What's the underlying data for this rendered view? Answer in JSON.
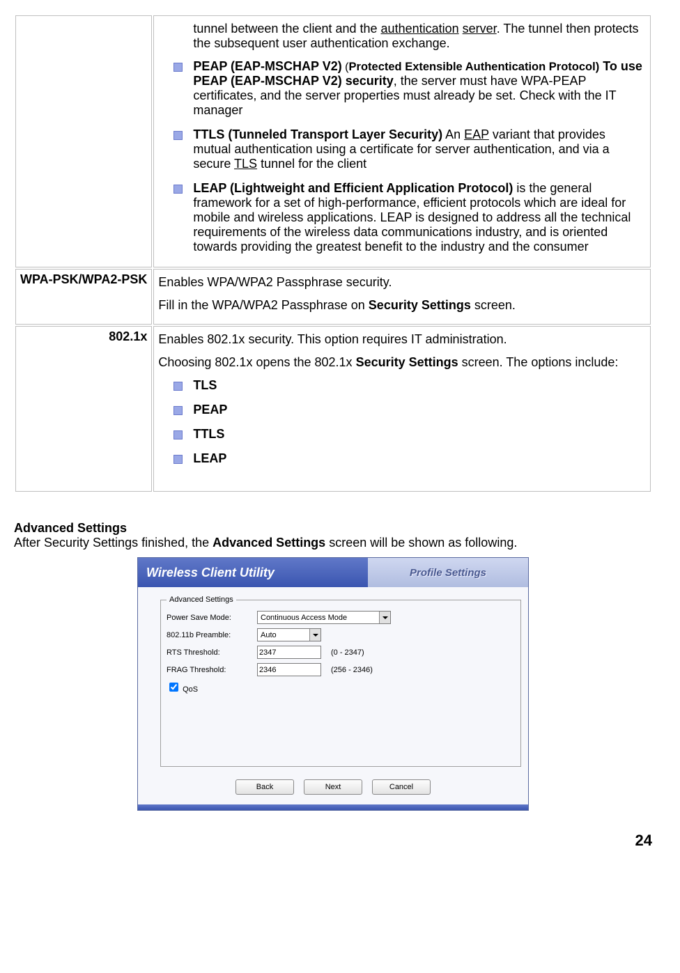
{
  "table": {
    "intro_text_pre": "tunnel between the client and the ",
    "intro_link1": "authentication",
    "intro_text_mid": " ",
    "intro_link2": "server",
    "intro_text_post": ". The tunnel then protects the subsequent user authentication exchange.",
    "items": [
      {
        "lead_bold": "PEAP (EAP-MSCHAP V2)",
        "lead_small": " (",
        "lead_bold2": "Protected Extensible Authentication Protocol)",
        "mid_bold": " To use PEAP (EAP-MSCHAP V2) security",
        "rest": ", the server must have WPA-PEAP certificates, and the server properties must already be set. Check with the IT manager"
      },
      {
        "lead_bold": "TTLS  (Tunneled Transport Layer Security)",
        "rest_pre": " An ",
        "link1": "EAP",
        "rest_mid": " variant that provides mutual authentication using a certificate for server authentication, and via a secure ",
        "link2": "TLS",
        "rest_post": " tunnel for the client"
      },
      {
        "lead_bold": "LEAP    (Lightweight and Efficient Application Protocol)",
        "rest": " is the general framework for a set of high-performance, efficient protocols which are ideal for mobile and wireless applications. LEAP is designed to address all the technical requirements of the wireless data communications industry, and is oriented towards providing the greatest benefit to the industry and the consumer"
      }
    ],
    "row2": {
      "label": "WPA-PSK/WPA2-PSK",
      "line1": "Enables WPA/WPA2 Passphrase security.",
      "line2_pre": "Fill in the WPA/WPA2 Passphrase on ",
      "line2_bold": "Security Settings",
      "line2_post": " screen."
    },
    "row3": {
      "label": "802.1x",
      "line1": "Enables 802.1x security.   This option requires IT administration.",
      "line2_pre": "Choosing 802.1x opens the 802.1x ",
      "line2_bold": "Security Settings",
      "line2_post": " screen. The options include:",
      "opts": [
        "TLS",
        "PEAP",
        "TTLS",
        "LEAP"
      ]
    }
  },
  "advanced": {
    "heading": "Advanced Settings",
    "intro_pre": "After Security Settings finished, the ",
    "intro_bold": "Advanced Settings",
    "intro_post": " screen will be shown as following."
  },
  "shot": {
    "window_title": "Wireless Client Utility",
    "tab": "Profile Settings",
    "legend": "Advanced Settings",
    "rows": {
      "psm_label": "Power Save Mode:",
      "psm_value": "Continuous Access Mode",
      "pre_label": "802.11b Preamble:",
      "pre_value": "Auto",
      "rts_label": "RTS Threshold:",
      "rts_value": "2347",
      "rts_range": "(0 - 2347)",
      "frag_label": "FRAG Threshold:",
      "frag_value": "2346",
      "frag_range": "(256 - 2346)",
      "qos_label": "QoS"
    },
    "buttons": {
      "back": "Back",
      "next": "Next",
      "cancel": "Cancel"
    }
  },
  "page_number": "24"
}
